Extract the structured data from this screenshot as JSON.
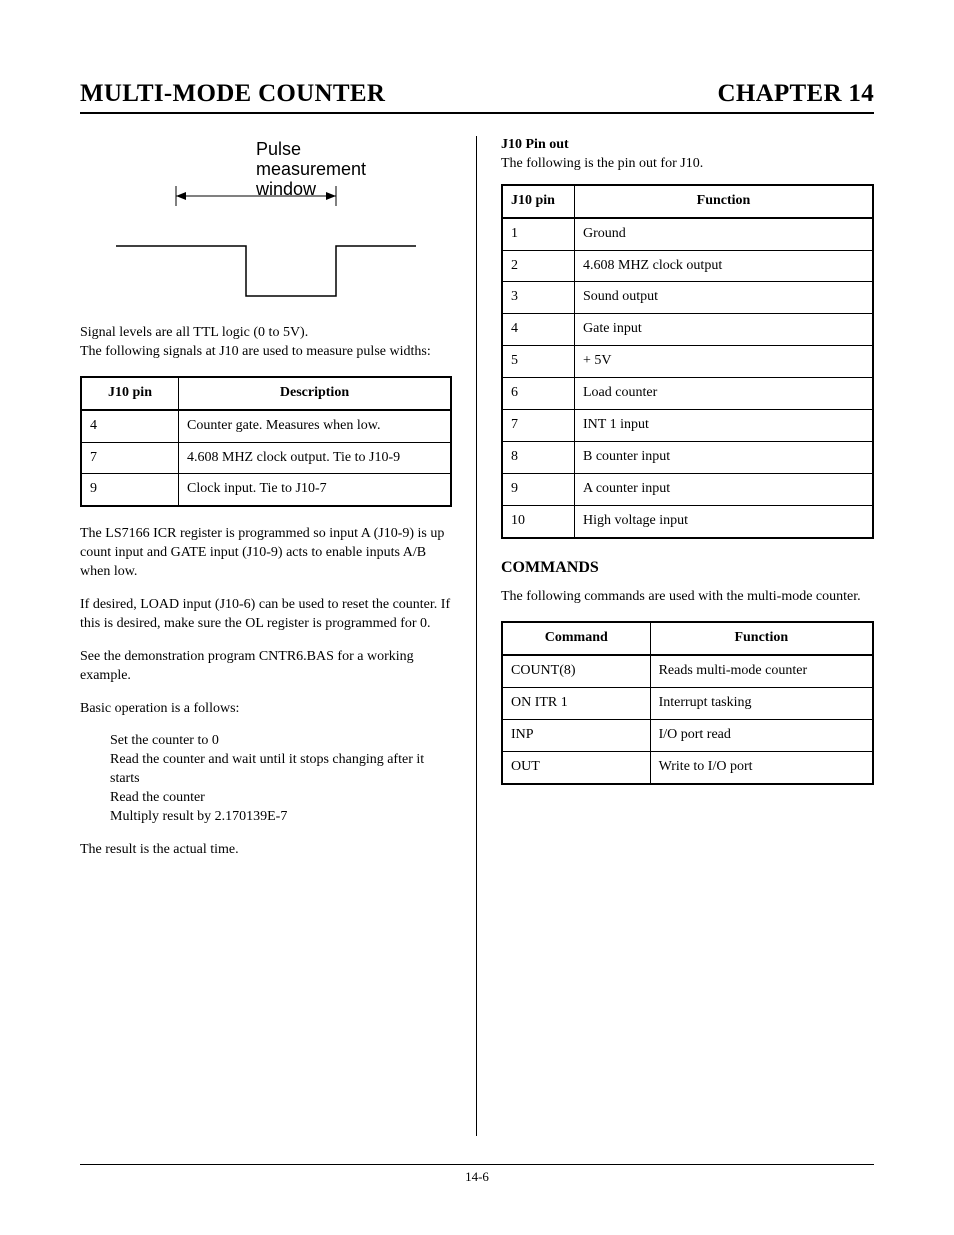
{
  "header": {
    "left": "MULTI-MODE COUNTER",
    "right": "CHAPTER 14"
  },
  "left": {
    "diagram_label_1": "Pulse measurement",
    "diagram_label_2": "window",
    "p1": "Signal levels are all TTL logic (0 to 5V).",
    "p2": "The following signals at J10 are used to measure pulse widths:",
    "table1_headers": {
      "c1": "J10 pin",
      "c2": "Description"
    },
    "table1_rows": [
      {
        "c1": "4",
        "c2": "Counter gate.  Measures when low."
      },
      {
        "c1": "7",
        "c2": "4.608 MHZ clock output.  Tie to J10-9"
      },
      {
        "c1": "9",
        "c2": "Clock input.  Tie to J10-7"
      }
    ],
    "p3": "The LS7166 ICR register is programmed so input A (J10-9) is up count input and GATE input (J10-9) acts to enable inputs A/B when low.",
    "p4": "If desired, LOAD input (J10-6) can be used to reset the counter.  If this is desired,  make sure the OL register is programmed for 0.",
    "p5": "See the demonstration program CNTR6.BAS for a working example.",
    "p6": "Basic operation is a follows:",
    "steps": [
      "Set the counter to 0",
      "Read the counter and wait until it stops changing after it starts",
      "Read the counter",
      "Multiply result by 2.170139E-7"
    ],
    "p7": "The result is the actual time."
  },
  "right": {
    "pinout_title": "J10 Pin out",
    "pinout_intro": "The following is the pin out for J10.",
    "table2_headers": {
      "c1": "J10 pin",
      "c2": "Function"
    },
    "table2_rows": [
      {
        "c1": "1",
        "c2": "Ground"
      },
      {
        "c1": "2",
        "c2": "4.608 MHZ clock output"
      },
      {
        "c1": "3",
        "c2": "Sound output"
      },
      {
        "c1": "4",
        "c2": "Gate input"
      },
      {
        "c1": "5",
        "c2": "+ 5V"
      },
      {
        "c1": "6",
        "c2": "Load counter"
      },
      {
        "c1": "7",
        "c2": "INT 1 input"
      },
      {
        "c1": "8",
        "c2": "B counter input"
      },
      {
        "c1": "9",
        "c2": "A counter input"
      },
      {
        "c1": "10",
        "c2": "High voltage input"
      }
    ],
    "commands_title": "COMMANDS",
    "commands_intro": "The following commands are used with the multi-mode counter.",
    "table3_headers": {
      "c1": "Command",
      "c2": "Function"
    },
    "table3_rows": [
      {
        "c1": "COUNT(8)",
        "c2": "Reads multi-mode counter"
      },
      {
        "c1": "ON ITR 1",
        "c2": "Interrupt tasking"
      },
      {
        "c1": "INP",
        "c2": "I/O port read"
      },
      {
        "c1": "OUT",
        "c2": "Write to I/O port"
      }
    ]
  },
  "footer": "14-6"
}
